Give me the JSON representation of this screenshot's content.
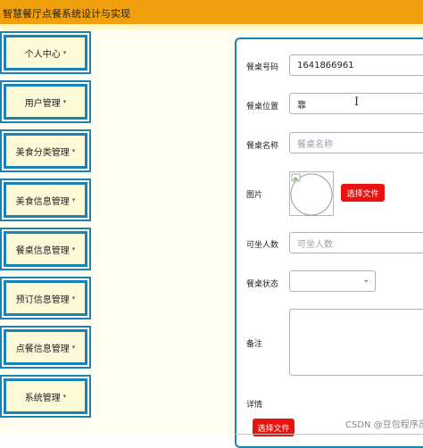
{
  "app": {
    "title": "智慧餐厅点餐系统设计与实现"
  },
  "sidebar": {
    "caret_glyph": "▾",
    "items": [
      {
        "label": "个人中心"
      },
      {
        "label": "用户管理"
      },
      {
        "label": "美食分类管理"
      },
      {
        "label": "美食信息管理"
      },
      {
        "label": "餐桌信息管理"
      },
      {
        "label": "预订信息管理"
      },
      {
        "label": "点餐信息管理"
      },
      {
        "label": "系统管理"
      }
    ]
  },
  "form": {
    "table_number": {
      "label": "餐桌号码",
      "value": "1641866961"
    },
    "table_location": {
      "label": "餐桌位置",
      "value": "靠"
    },
    "table_name": {
      "label": "餐桌名称",
      "placeholder": "餐桌名称"
    },
    "image": {
      "label": "图片",
      "button": "选择文件"
    },
    "seats": {
      "label": "可坐人数",
      "placeholder": "可坐人数"
    },
    "status": {
      "label": "餐桌状态",
      "value": ""
    },
    "remark": {
      "label": "备注"
    },
    "details": {
      "label": "详情",
      "button": "选择文件"
    }
  },
  "watermark": "CSDN @豆包程序员",
  "colors": {
    "topbar": "#f0a00c",
    "accent_blue": "#1a83b5",
    "menu_face": "#fdfad8",
    "button_red": "#e8130f",
    "content_bg": "#fffef0"
  }
}
